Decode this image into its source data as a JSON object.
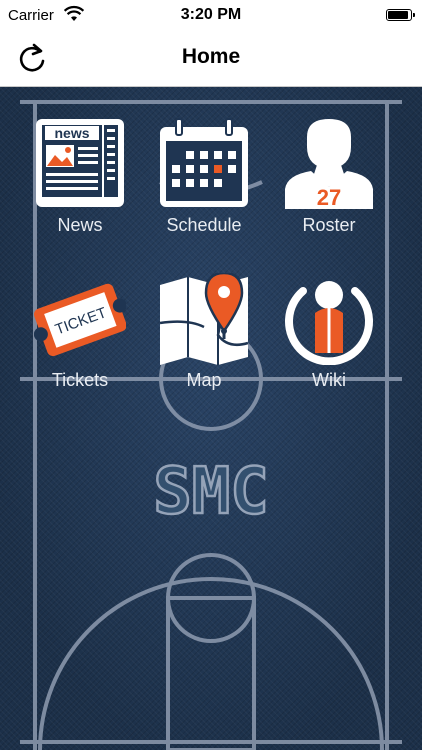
{
  "status_bar": {
    "carrier": "Carrier",
    "time": "3:20 PM",
    "battery_level": 0.95
  },
  "nav": {
    "title": "Home"
  },
  "court": {
    "logo_text": "SMC"
  },
  "tiles": [
    {
      "label": "News",
      "icon": "newspaper-icon",
      "badge": "news"
    },
    {
      "label": "Schedule",
      "icon": "calendar-icon"
    },
    {
      "label": "Roster",
      "icon": "player-jersey-icon",
      "badge": "27"
    },
    {
      "label": "Tickets",
      "icon": "ticket-icon",
      "badge": "TICKET"
    },
    {
      "label": "Map",
      "icon": "map-pin-icon"
    },
    {
      "label": "Wiki",
      "icon": "wiki-logo-icon"
    }
  ],
  "colors": {
    "accent": "#ea5a25",
    "court": "#1f3552",
    "lines": "#8e9bb0",
    "icon": "#ffffff"
  }
}
